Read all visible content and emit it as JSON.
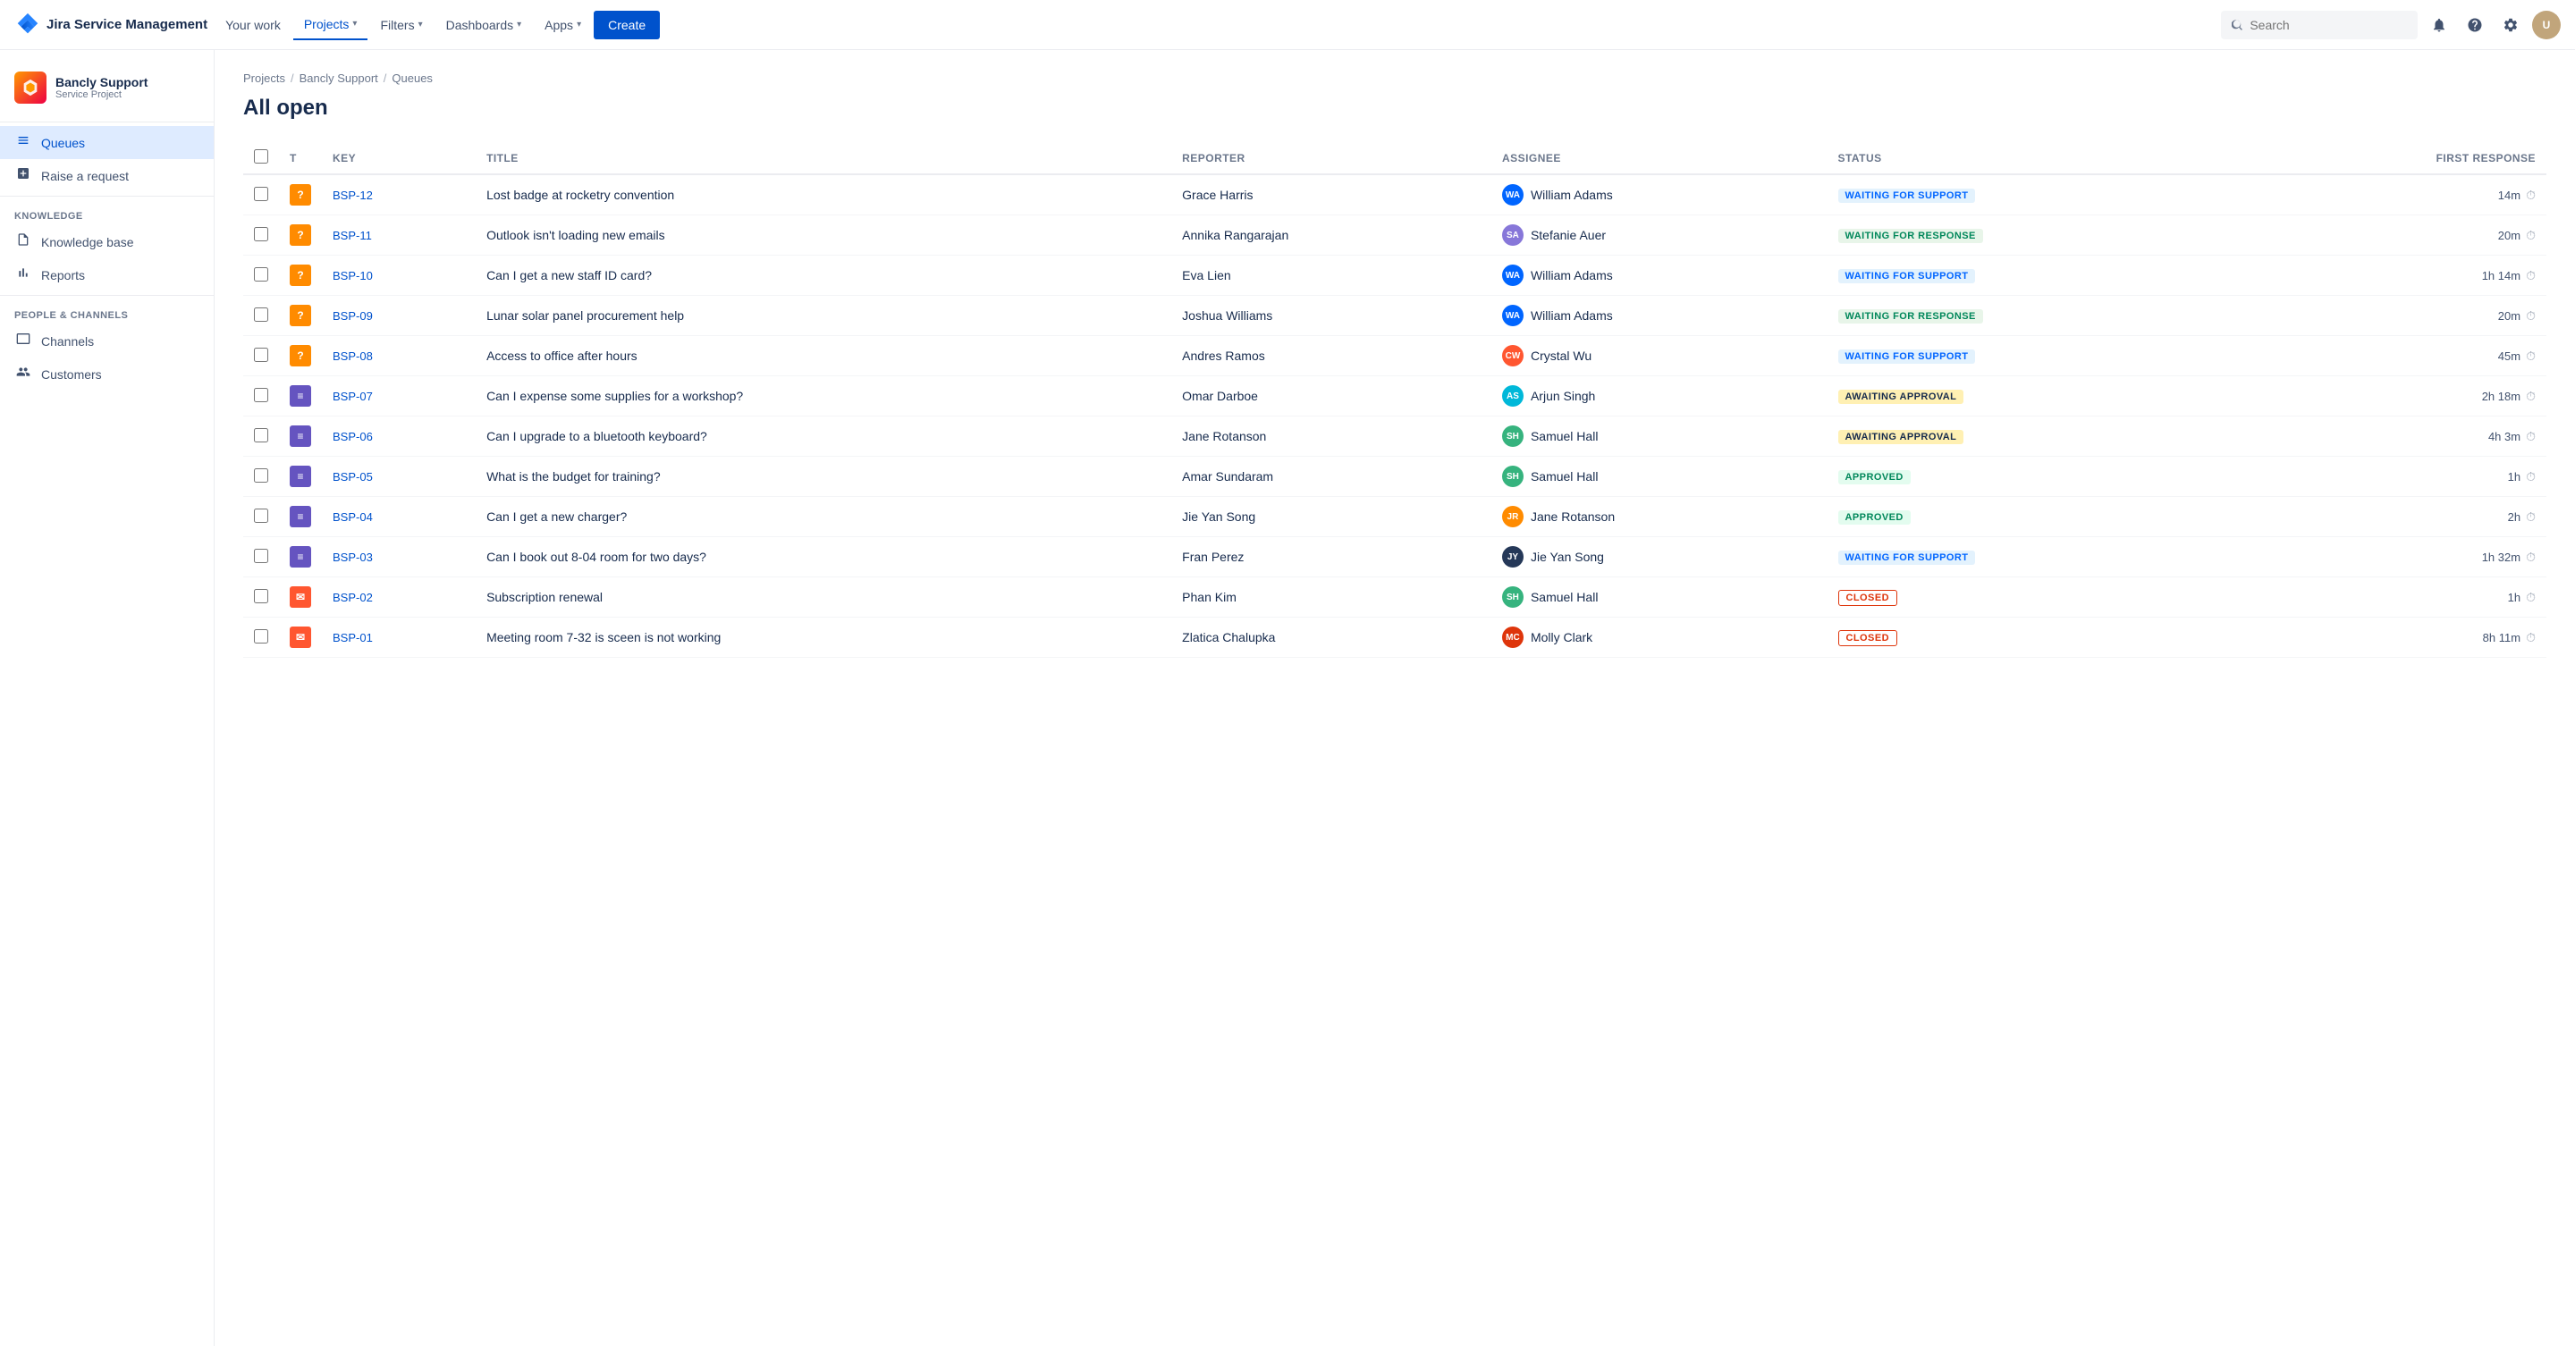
{
  "topnav": {
    "brand": "Jira Service Management",
    "nav_items": [
      {
        "label": "Your work",
        "active": false
      },
      {
        "label": "Projects",
        "has_dropdown": true,
        "active": true
      },
      {
        "label": "Filters",
        "has_dropdown": true,
        "active": false
      },
      {
        "label": "Dashboards",
        "has_dropdown": true,
        "active": false
      },
      {
        "label": "Apps",
        "has_dropdown": true,
        "active": false
      }
    ],
    "create_label": "Create",
    "search_placeholder": "Search"
  },
  "sidebar": {
    "project_name": "Bancly Support",
    "project_type": "Service Project",
    "nav_items": [
      {
        "label": "Queues",
        "icon": "☰",
        "active": true
      },
      {
        "label": "Raise a request",
        "icon": "+",
        "active": false
      }
    ],
    "knowledge_section": "KNOWLEDGE",
    "knowledge_items": [
      {
        "label": "Knowledge base",
        "icon": "📄"
      },
      {
        "label": "Reports",
        "icon": "📊"
      }
    ],
    "people_section": "PEOPLE & CHANNELS",
    "people_items": [
      {
        "label": "Channels",
        "icon": "🖥"
      },
      {
        "label": "Customers",
        "icon": "👥"
      }
    ]
  },
  "breadcrumb": {
    "items": [
      "Projects",
      "Bancly Support",
      "Queues"
    ]
  },
  "page_title": "All open",
  "table": {
    "columns": [
      "",
      "T",
      "Key",
      "Title",
      "Reporter",
      "Assignee",
      "Status",
      "First response"
    ],
    "rows": [
      {
        "key": "BSP-12",
        "type": "question",
        "title": "Lost badge at rocketry convention",
        "reporter": "Grace Harris",
        "assignee": "William Adams",
        "assignee_initials": "WA",
        "assignee_color": "av-blue",
        "status": "WAITING FOR SUPPORT",
        "status_class": "status-waiting-support",
        "first_response": "14m"
      },
      {
        "key": "BSP-11",
        "type": "question",
        "title": "Outlook isn't loading new emails",
        "reporter": "Annika Rangarajan",
        "assignee": "Stefanie Auer",
        "assignee_initials": "SA",
        "assignee_color": "av-purple",
        "status": "WAITING FOR RESPONSE",
        "status_class": "status-waiting-response",
        "first_response": "20m"
      },
      {
        "key": "BSP-10",
        "type": "question",
        "title": "Can I get a new staff ID card?",
        "reporter": "Eva Lien",
        "assignee": "William Adams",
        "assignee_initials": "WA",
        "assignee_color": "av-blue",
        "status": "WAITING FOR SUPPORT",
        "status_class": "status-waiting-support",
        "first_response": "1h 14m"
      },
      {
        "key": "BSP-09",
        "type": "question",
        "title": "Lunar solar panel procurement help",
        "reporter": "Joshua Williams",
        "assignee": "William Adams",
        "assignee_initials": "WA",
        "assignee_color": "av-blue",
        "status": "WAITING FOR RESPONSE",
        "status_class": "status-waiting-response",
        "first_response": "20m"
      },
      {
        "key": "BSP-08",
        "type": "question",
        "title": "Access to office after hours",
        "reporter": "Andres Ramos",
        "assignee": "Crystal Wu",
        "assignee_initials": "CW",
        "assignee_color": "av-pink",
        "status": "WAITING FOR SUPPORT",
        "status_class": "status-waiting-support",
        "first_response": "45m"
      },
      {
        "key": "BSP-07",
        "type": "service",
        "title": "Can I expense some supplies for a workshop?",
        "reporter": "Omar Darboe",
        "assignee": "Arjun Singh",
        "assignee_initials": "AS",
        "assignee_color": "av-teal",
        "status": "AWAITING APPROVAL",
        "status_class": "status-awaiting-approval",
        "first_response": "2h 18m"
      },
      {
        "key": "BSP-06",
        "type": "service",
        "title": "Can I upgrade to a bluetooth keyboard?",
        "reporter": "Jane Rotanson",
        "assignee": "Samuel Hall",
        "assignee_initials": "SH",
        "assignee_color": "av-green",
        "status": "AWAITING APPROVAL",
        "status_class": "status-awaiting-approval",
        "first_response": "4h 3m"
      },
      {
        "key": "BSP-05",
        "type": "service",
        "title": "What is the budget for training?",
        "reporter": "Amar Sundaram",
        "assignee": "Samuel Hall",
        "assignee_initials": "SH",
        "assignee_color": "av-green",
        "status": "APPROVED",
        "status_class": "status-approved",
        "first_response": "1h"
      },
      {
        "key": "BSP-04",
        "type": "service",
        "title": "Can I get a new charger?",
        "reporter": "Jie Yan Song",
        "assignee": "Jane Rotanson",
        "assignee_initials": "JR",
        "assignee_color": "av-orange",
        "status": "APPROVED",
        "status_class": "status-approved",
        "first_response": "2h"
      },
      {
        "key": "BSP-03",
        "type": "service",
        "title": "Can I book out 8-04 room for two days?",
        "reporter": "Fran Perez",
        "assignee": "Jie Yan Song",
        "assignee_initials": "JY",
        "assignee_color": "av-darkblue",
        "status": "WAITING FOR SUPPORT",
        "status_class": "status-waiting-support",
        "first_response": "1h 32m"
      },
      {
        "key": "BSP-02",
        "type": "email",
        "title": "Subscription renewal",
        "reporter": "Phan Kim",
        "assignee": "Samuel Hall",
        "assignee_initials": "SH",
        "assignee_color": "av-green",
        "status": "CLOSED",
        "status_class": "status-closed",
        "first_response": "1h"
      },
      {
        "key": "BSP-01",
        "type": "email",
        "title": "Meeting room 7-32 is sceen is not working",
        "reporter": "Zlatica Chalupka",
        "assignee": "Molly Clark",
        "assignee_initials": "MC",
        "assignee_color": "av-red",
        "status": "CLOSED",
        "status_class": "status-closed",
        "first_response": "8h 11m"
      }
    ]
  }
}
